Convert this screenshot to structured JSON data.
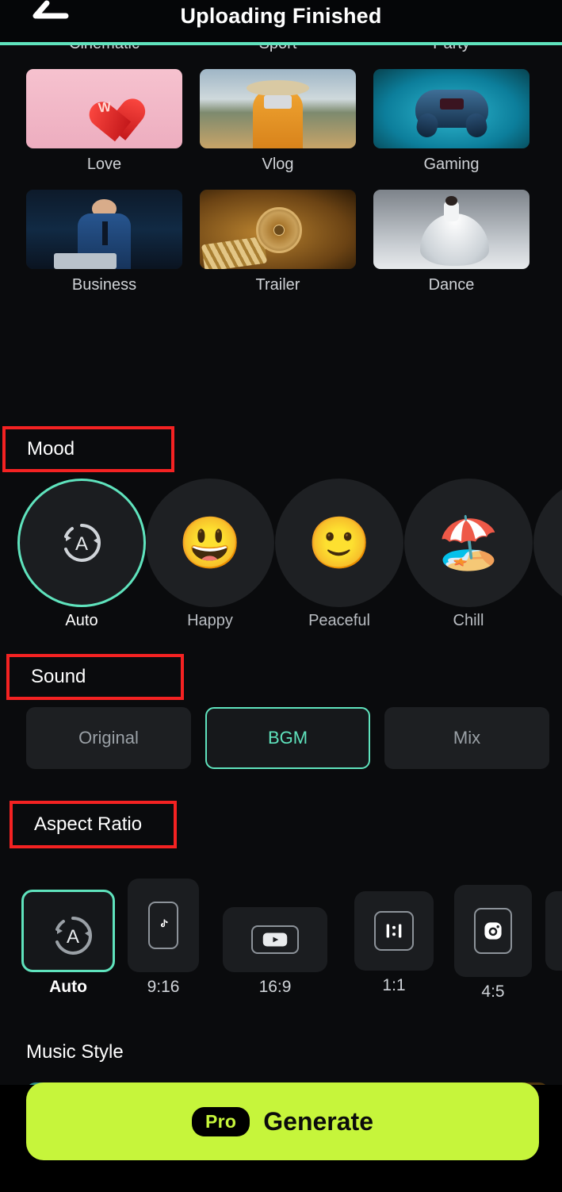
{
  "header": {
    "title": "Uploading Finished",
    "back_icon": "back-arrow-icon",
    "progress_color": "#5fe3bd"
  },
  "templates": {
    "rows": [
      [
        {
          "label": "Cinematic",
          "art": "art-cinematic"
        },
        {
          "label": "Sport",
          "art": "art-sport"
        },
        {
          "label": "Party",
          "art": "art-party"
        }
      ],
      [
        {
          "label": "Love",
          "art": "art-love"
        },
        {
          "label": "Vlog",
          "art": "art-vlog"
        },
        {
          "label": "Gaming",
          "art": "art-gaming"
        }
      ],
      [
        {
          "label": "Business",
          "art": "art-business"
        },
        {
          "label": "Trailer",
          "art": "art-trailer"
        },
        {
          "label": "Dance",
          "art": "art-dance"
        }
      ]
    ]
  },
  "mood": {
    "title": "Mood",
    "annotated": true,
    "items": [
      {
        "label": "Auto",
        "icon": "auto-rotate-icon",
        "emoji": "",
        "selected": true
      },
      {
        "label": "Happy",
        "icon": "grinning-face-emoji",
        "emoji": "😃",
        "selected": false
      },
      {
        "label": "Peaceful",
        "icon": "slightly-smiling-face-emoji",
        "emoji": "🙂",
        "selected": false
      },
      {
        "label": "Chill",
        "icon": "beach-umbrella-emoji",
        "emoji": "🏖️",
        "selected": false
      }
    ]
  },
  "sound": {
    "title": "Sound",
    "annotated": true,
    "options": [
      {
        "label": "Original",
        "selected": false
      },
      {
        "label": "BGM",
        "selected": true
      },
      {
        "label": "Mix",
        "selected": false
      }
    ]
  },
  "aspect_ratio": {
    "title": "Aspect Ratio",
    "annotated": true,
    "options": [
      {
        "label": "Auto",
        "icon": "auto-rotate-icon",
        "selected": true
      },
      {
        "label": "9:16",
        "icon": "tiktok-icon",
        "selected": false
      },
      {
        "label": "16:9",
        "icon": "youtube-icon",
        "selected": false
      },
      {
        "label": "1:1",
        "icon": "square-ratio-icon",
        "selected": false
      },
      {
        "label": "4:5",
        "icon": "instagram-icon",
        "selected": false
      }
    ]
  },
  "music_style": {
    "title": "Music Style",
    "cards": [
      {
        "selected": true,
        "color": "#1c4f73"
      },
      {
        "selected": false,
        "color": "#8a3520"
      },
      {
        "selected": false,
        "color": "#7a5416"
      }
    ]
  },
  "generate": {
    "badge": "Pro",
    "label": "Generate",
    "button_color": "#c6f53b"
  },
  "colors": {
    "accent_teal": "#5fe3bd",
    "annotation_red": "#f42222",
    "lime": "#c6f53b"
  }
}
